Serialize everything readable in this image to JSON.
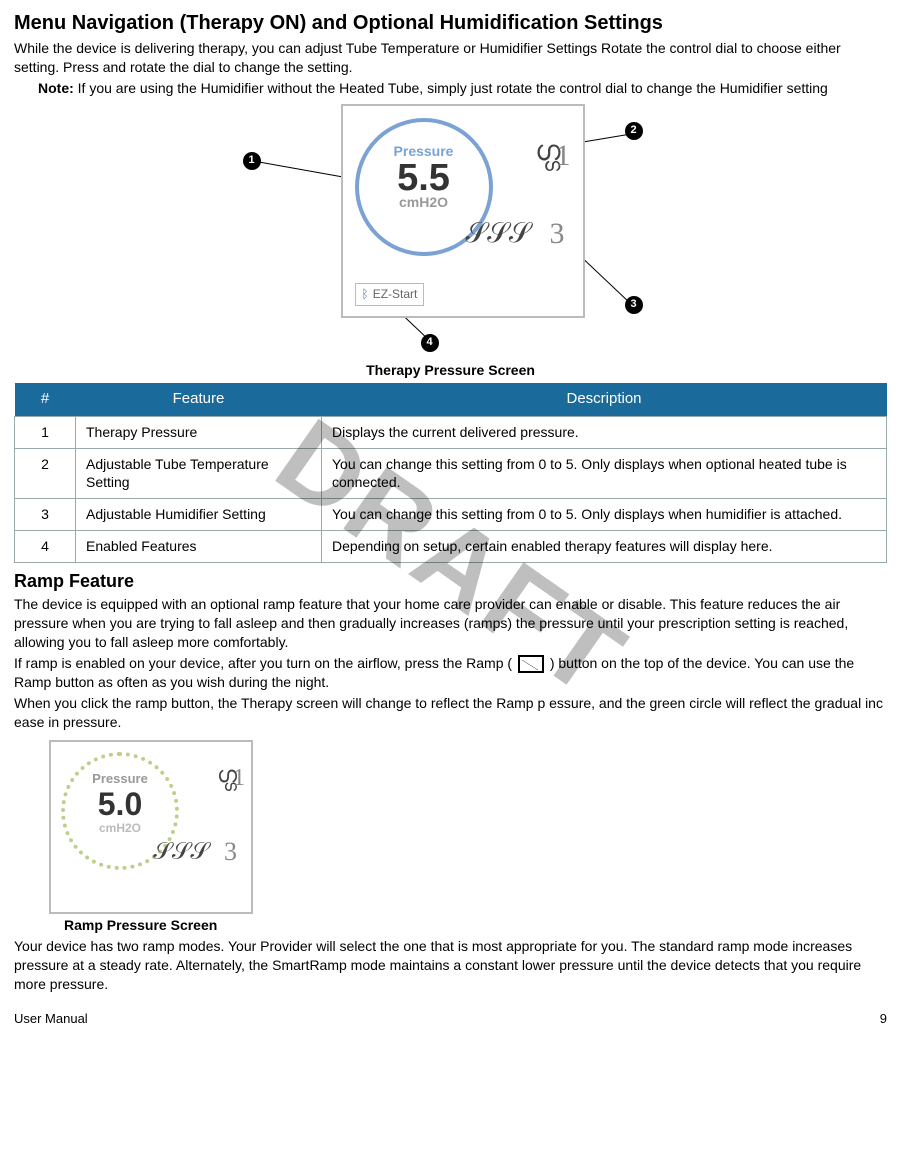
{
  "watermark": "DRAFT",
  "heading1": "Menu Navigation (Therapy ON) and Optional Humidification Settings",
  "intro": "While the device is delivering therapy, you can adjust Tube Temperature or Humidifier Settings  Rotate the control dial to choose either setting. Press and rotate the dial to change the setting.",
  "note_label": "Note:",
  "note_text": " If you are using the Humidifier without the Heated Tube, simply just rotate the control dial to change the Humidifier setting",
  "diagram": {
    "pressure_label": "Pressure",
    "pressure_value": "5.5",
    "pressure_unit": "cmH2O",
    "tube_value": "1",
    "humidifier_value": "3",
    "ez_start": "EZ-Start",
    "callouts": {
      "c1": "1",
      "c2": "2",
      "c3": "3",
      "c4": "4"
    }
  },
  "caption1": "Therapy Pressure Screen",
  "table": {
    "headers": {
      "num": "#",
      "feature": "Feature",
      "desc": "Description"
    },
    "rows": [
      {
        "num": "1",
        "feature": "Therapy Pressure",
        "desc": "Displays the current delivered pressure."
      },
      {
        "num": "2",
        "feature": "Adjustable Tube Temperature Setting",
        "desc": "You can change this setting from 0 to 5. Only displays when optional heated tube is connected."
      },
      {
        "num": "3",
        "feature": "Adjustable Humidifier Setting",
        "desc": "You can change this setting from 0 to 5. Only displays when humidifier is attached."
      },
      {
        "num": "4",
        "feature": "Enabled Features",
        "desc": "Depending on setup, certain enabled therapy features will display here."
      }
    ]
  },
  "heading2": "Ramp Feature",
  "ramp_p1": "The device is equipped with an optional ramp feature that your home care provider can enable or disable.  This feature reduces the air pressure when you are trying to fall asleep and then gradually increases (ramps) the pressure until your prescription setting is reached, allowing you to fall asleep more comfortably.",
  "ramp_p2a": "If ramp is enabled on your device, after you turn on the airflow, press the Ramp ( ",
  "ramp_p2b": " ) button on the top of the device. You can use the Ramp button as often as you wish during the night.",
  "ramp_p3": "When you click the ramp button, the Therapy screen will change to reflect the Ramp p  essure, and the green circle will reflect the gradual inc  ease in pressure.",
  "ramp_screen": {
    "pressure_label": "Pressure",
    "pressure_value": "5.0",
    "pressure_unit": "cmH2O",
    "tube_value": "1",
    "humidifier_value": "3"
  },
  "caption2": "Ramp Pressure Screen",
  "ramp_p4": "Your device has two ramp modes. Your Provider will select the one that is most appropriate for you. The standard ramp mode increases pressure at a steady rate.  Alternately, the SmartRamp mode maintains a constant lower pressure until the device detects that you require more pressure.",
  "footer": {
    "left": "User Manual",
    "right": "9"
  }
}
